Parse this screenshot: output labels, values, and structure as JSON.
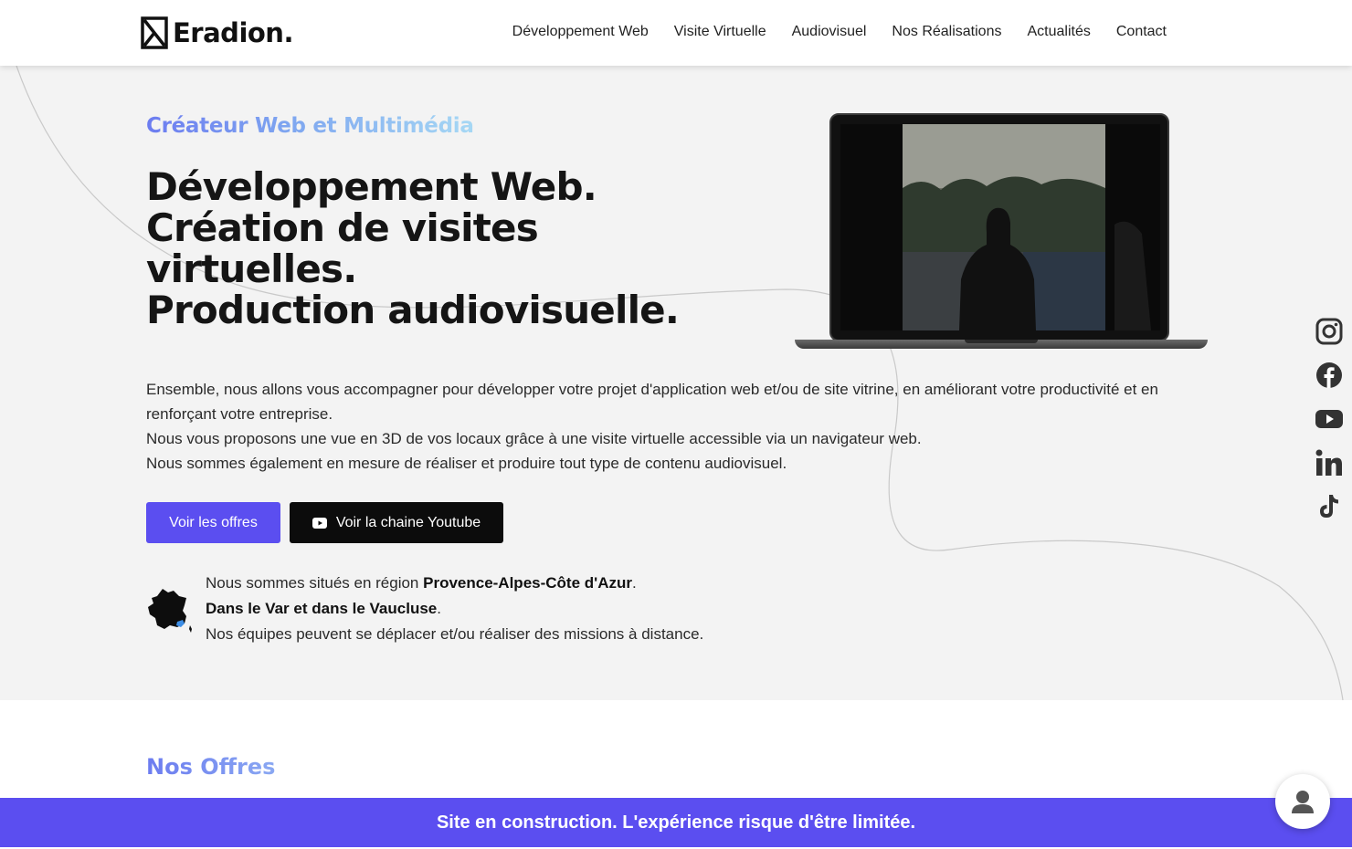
{
  "header": {
    "logo_text": "Eradion.",
    "nav": [
      {
        "label": "Développement Web"
      },
      {
        "label": "Visite Virtuelle"
      },
      {
        "label": "Audiovisuel"
      },
      {
        "label": "Nos Réalisations"
      },
      {
        "label": "Actualités"
      },
      {
        "label": "Contact"
      }
    ]
  },
  "hero": {
    "subtitle": "Créateur Web et Multimédia",
    "headline": [
      "Développement Web.",
      "Création de visites",
      "virtuelles.",
      "Production audiovisuelle."
    ],
    "description": [
      "Ensemble, nous allons vous accompagner pour développer votre projet d'application web et/ou de site vitrine, en améliorant votre productivité et en renforçant votre entreprise.",
      "Nous vous proposons une vue en 3D de vos locaux grâce à une visite virtuelle accessible via un navigateur web.",
      "Nous sommes également en mesure de réaliser et produire tout type de contenu audiovisuel."
    ],
    "buttons": {
      "offers": "Voir les offres",
      "youtube": "Voir la chaine Youtube"
    },
    "location": {
      "line1_prefix": "Nous sommes situés en région ",
      "line1_bold": "Provence-Alpes-Côte d'Azur",
      "line1_suffix": ".",
      "line2_bold": "Dans le Var et dans le Vaucluse",
      "line2_suffix": ".",
      "line3": "Nos équipes peuvent se déplacer et/ou réaliser des missions à distance."
    }
  },
  "socials": [
    "instagram-icon",
    "facebook-icon",
    "youtube-icon",
    "linkedin-icon",
    "tiktok-icon"
  ],
  "offers": {
    "title": "Nos Offres"
  },
  "banner": {
    "text": "Site en construction. L'expérience risque d'être limitée."
  },
  "colors": {
    "accent": "#5b4ef0",
    "hero_bg": "#f3f3f3",
    "dark_button": "#0c0c0c"
  }
}
